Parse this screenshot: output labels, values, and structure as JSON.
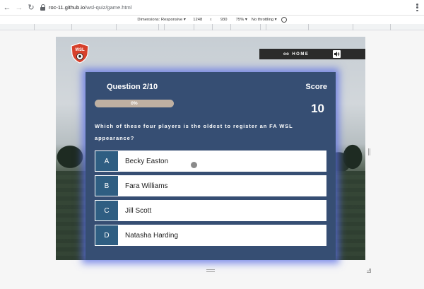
{
  "browser": {
    "url_host": "roc-11.github.io",
    "url_path": "/wsl-quiz/game.html"
  },
  "devtools": {
    "dimensions_label": "Dimensions: Responsive ▾",
    "width": "1248",
    "times": "x",
    "height": "930",
    "zoom": "75% ▾",
    "throttling": "No throttling ▾"
  },
  "site": {
    "logo_text": "WSL",
    "nav": {
      "home_dots": "oo",
      "home_label": "HOME"
    }
  },
  "quiz": {
    "question_heading": "Question 2/10",
    "score_label": "Score",
    "score_value": "10",
    "progress_text": "0%",
    "progress_fraction": 0.0,
    "question": "Which of these four players is the oldest to register an FA WSL appearance?",
    "answers": [
      {
        "letter": "A",
        "text": "Becky Easton"
      },
      {
        "letter": "B",
        "text": "Fara Williams"
      },
      {
        "letter": "C",
        "text": "Jill Scott"
      },
      {
        "letter": "D",
        "text": "Natasha Harding"
      }
    ]
  },
  "colors": {
    "card_bg": "#364e73",
    "letter_bg": "#2f5e82",
    "glow": "#5a6ee6",
    "nav_bar": "#2b2b2b"
  }
}
